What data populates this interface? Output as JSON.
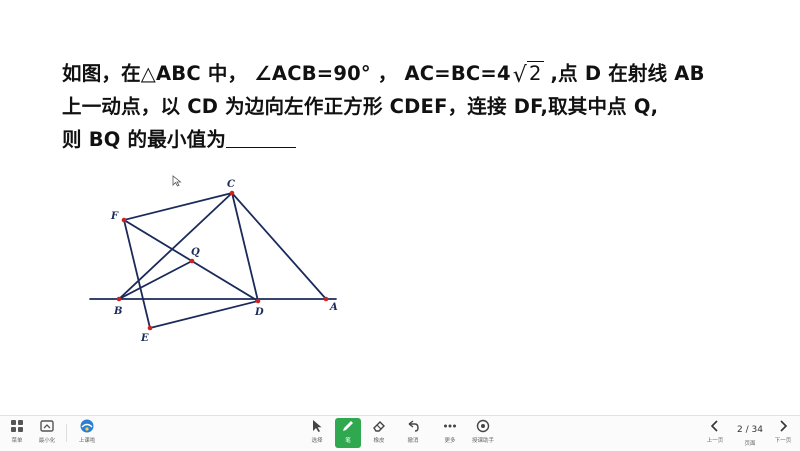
{
  "question": {
    "line1_a": "如图，在△ABC 中， ∠ACB=90° ， AC=BC=4",
    "line1_sqrt": "2",
    "line1_b": " ,点 D  在射线 AB",
    "line2": "上一动点，以 CD 为边向左作正方形 CDEF，连接 DF,取其中点 Q,",
    "line3": "则 BQ 的最小值为"
  },
  "figure": {
    "points": {
      "A": {
        "label": "A"
      },
      "B": {
        "label": "B"
      },
      "C": {
        "label": "C"
      },
      "D": {
        "label": "D"
      },
      "E": {
        "label": "E"
      },
      "F": {
        "label": "F"
      },
      "Q": {
        "label": "Q"
      }
    },
    "stroke_color": "#1a2a5a",
    "point_color": "#cc2222"
  },
  "toolbar": {
    "left": [
      {
        "label": "菜单",
        "icon": "menu-icon"
      },
      {
        "label": "最小化",
        "icon": "minimize-icon"
      },
      {
        "label": "上课啦",
        "icon": "app-logo-icon"
      }
    ],
    "center": [
      {
        "label": "选择",
        "icon": "cursor-icon"
      },
      {
        "label": "笔",
        "icon": "pen-icon"
      },
      {
        "label": "橡皮",
        "icon": "eraser-icon"
      },
      {
        "label": "撤消",
        "icon": "undo-icon"
      },
      {
        "label": "更多",
        "icon": "more-icon"
      },
      {
        "label": "授课助手",
        "icon": "assistant-icon"
      }
    ],
    "right": {
      "prev_label": "上一页",
      "page_indicator": "2 / 34",
      "current_label": "页面",
      "next_label": "下一页"
    },
    "accent": "#2fa84f"
  }
}
